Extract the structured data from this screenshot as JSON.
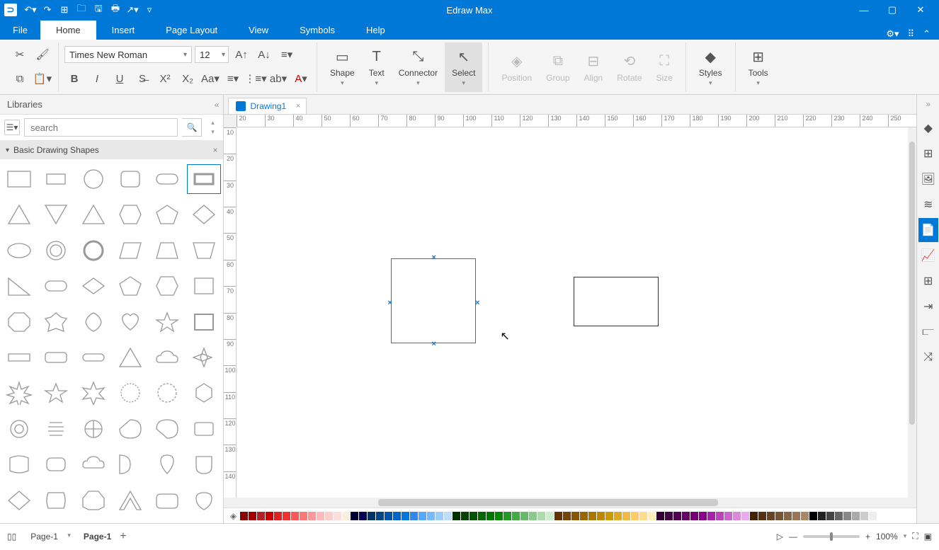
{
  "app": {
    "title": "Edraw Max"
  },
  "menu": {
    "tabs": [
      "File",
      "Home",
      "Insert",
      "Page Layout",
      "View",
      "Symbols",
      "Help"
    ],
    "active": "Home"
  },
  "ribbon": {
    "font": "Times New Roman",
    "size": "12",
    "big": [
      {
        "id": "shape",
        "label": "Shape"
      },
      {
        "id": "text",
        "label": "Text"
      },
      {
        "id": "connector",
        "label": "Connector"
      },
      {
        "id": "select",
        "label": "Select",
        "active": true
      }
    ],
    "big2": [
      {
        "id": "position",
        "label": "Position",
        "disabled": true
      },
      {
        "id": "group",
        "label": "Group",
        "disabled": true
      },
      {
        "id": "align",
        "label": "Align",
        "disabled": true
      },
      {
        "id": "rotate",
        "label": "Rotate",
        "disabled": true
      },
      {
        "id": "size",
        "label": "Size",
        "disabled": true
      }
    ],
    "big3": [
      {
        "id": "styles",
        "label": "Styles"
      },
      {
        "id": "tools",
        "label": "Tools"
      }
    ]
  },
  "libraries": {
    "title": "Libraries",
    "search_placeholder": "search",
    "category": "Basic Drawing Shapes"
  },
  "doc": {
    "tab": "Drawing1"
  },
  "ruler_h": [
    "20",
    "30",
    "40",
    "50",
    "60",
    "70",
    "80",
    "90",
    "100",
    "110",
    "120",
    "130",
    "140",
    "150",
    "160",
    "170",
    "180",
    "190",
    "200",
    "210",
    "220",
    "230",
    "240",
    "250"
  ],
  "ruler_v": [
    "10",
    "20",
    "30",
    "40",
    "50",
    "60",
    "70",
    "80",
    "90",
    "100",
    "110",
    "120",
    "130",
    "140"
  ],
  "colors": [
    "#8b0000",
    "#a00000",
    "#b22222",
    "#c00",
    "#d22",
    "#e33",
    "#f55",
    "#f77",
    "#f99",
    "#fbb",
    "#fcc",
    "#fdd",
    "#fed",
    "#000033",
    "#000055",
    "#003366",
    "#004488",
    "#0055aa",
    "#0066cc",
    "#0077dd",
    "#3388ee",
    "#55aaff",
    "#77bbff",
    "#99ccff",
    "#bbddff",
    "#003300",
    "#004400",
    "#005500",
    "#006600",
    "#007700",
    "#008800",
    "#229922",
    "#44aa44",
    "#66bb66",
    "#88cc88",
    "#aaddaa",
    "#cceecc",
    "#663300",
    "#774400",
    "#885500",
    "#996600",
    "#aa7700",
    "#bb8800",
    "#cc9900",
    "#ddaa22",
    "#eebb44",
    "#ffcc66",
    "#ffdd88",
    "#ffeebb",
    "#330033",
    "#440044",
    "#550055",
    "#660066",
    "#770077",
    "#880088",
    "#aa22aa",
    "#bb44bb",
    "#cc66cc",
    "#dd88dd",
    "#eeaaee",
    "#442200",
    "#553311",
    "#664422",
    "#775533",
    "#886644",
    "#997755",
    "#aa8866",
    "#000",
    "#222",
    "#444",
    "#666",
    "#888",
    "#aaa",
    "#ccc",
    "#eee",
    "#fff"
  ],
  "status": {
    "page_select": "Page-1",
    "page_name": "Page-1",
    "zoom": "100%"
  }
}
